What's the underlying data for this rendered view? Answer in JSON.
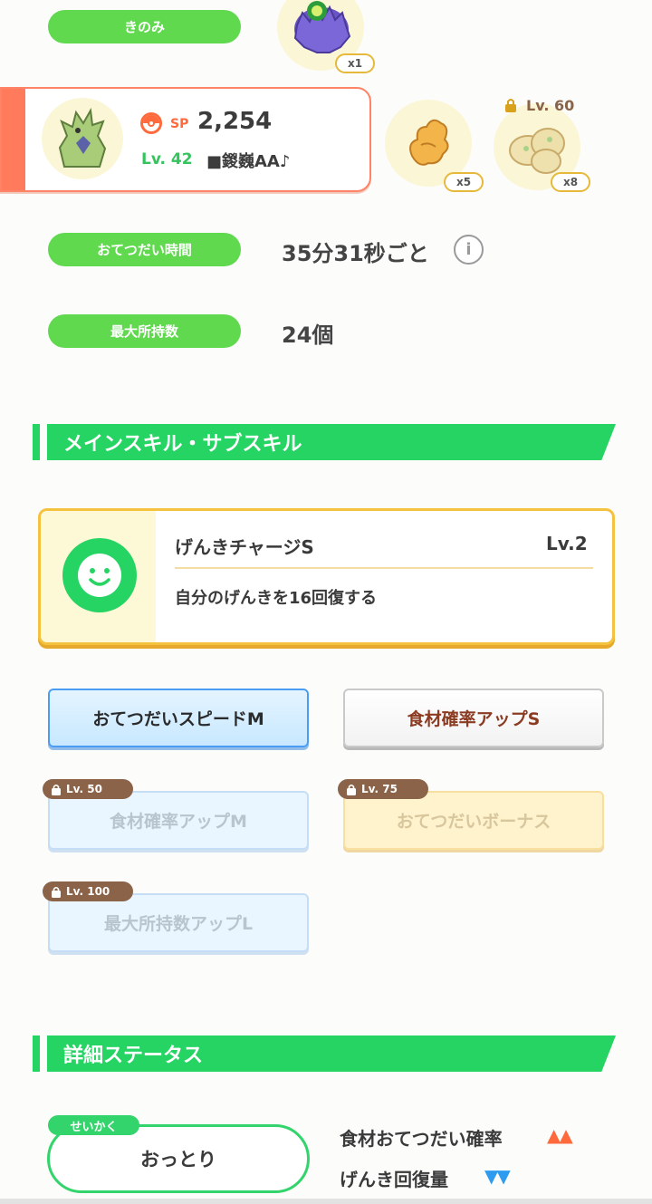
{
  "kinomi": {
    "label": "きのみ",
    "count": "x1",
    "icon": "berry-icon"
  },
  "pokemon": {
    "sp_label": "SP",
    "sp_value": "2,254",
    "level": "Lv. 42",
    "nickname": "■鍐巍AA♪",
    "icon": "pokemon-avatar"
  },
  "ingredients": [
    {
      "icon": "ginger-icon",
      "count": "x5"
    },
    {
      "icon": "potato-icon",
      "count": "x8",
      "lock_level": "Lv. 60"
    }
  ],
  "help_time": {
    "label": "おてつだい時間",
    "value": "35分31秒ごと"
  },
  "max_carry": {
    "label": "最大所持数",
    "value": "24個"
  },
  "skill_section": {
    "title": "メインスキル・サブスキル"
  },
  "main_skill": {
    "name": "げんきチャージS",
    "level": "Lv.2",
    "description": "自分のげんきを16回復する",
    "icon": "smile-face-icon"
  },
  "sub_skills": [
    {
      "label": "おてつだいスピードM",
      "style": "blue"
    },
    {
      "label": "食材確率アップS",
      "style": "white"
    },
    {
      "label": "食材確率アップM",
      "style": "lockblue",
      "lock_level": "Lv. 50"
    },
    {
      "label": "おてつだいボーナス",
      "style": "lockyellow",
      "lock_level": "Lv. 75"
    },
    {
      "label": "最大所持数アップL",
      "style": "lockblue",
      "lock_level": "Lv. 100"
    }
  ],
  "details_section": {
    "title": "詳細ステータス"
  },
  "nature": {
    "tag": "せいかく",
    "name": "おっとり",
    "up_effect": "食材おてつだい確率",
    "up_marks": "▲▲",
    "down_effect": "げんき回復量",
    "down_marks": "▼▼"
  },
  "colors": {
    "accent_green": "#25d462",
    "pill_green": "#60d94f",
    "up_orange": "#ff6a3d",
    "down_blue": "#2d9cf0",
    "card_red": "#ff7b5c"
  }
}
